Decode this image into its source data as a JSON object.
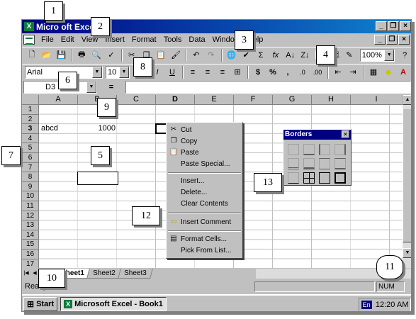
{
  "app": {
    "title": "Microsoft Excel - Book1",
    "title_visible": "Micro   oft Excel   1"
  },
  "menubar": {
    "items": [
      "File",
      "Edit",
      "View",
      "Insert",
      "Format",
      "Tools",
      "Data",
      "Window",
      "Help"
    ]
  },
  "toolbar": {
    "zoom": "100%",
    "font": "Arial",
    "size": "10",
    "currency": "$",
    "percent": "%",
    "autosum": "Σ",
    "function": "fx"
  },
  "formula_bar": {
    "name_box": "D3",
    "equals": "="
  },
  "sheet": {
    "columns": [
      "A",
      "B",
      "C",
      "D",
      "E",
      "F",
      "G",
      "H",
      "I"
    ],
    "rows": [
      "1",
      "2",
      "3",
      "4",
      "5",
      "6",
      "7",
      "8",
      "9",
      "10",
      "11",
      "12",
      "13",
      "14",
      "15",
      "16",
      "17"
    ],
    "cells": {
      "A3": "abcd",
      "B3": "1000"
    }
  },
  "tabs": [
    "Sheet1",
    "Sheet2",
    "Sheet3"
  ],
  "status": {
    "ready": "Ready",
    "num": "NUM"
  },
  "context_menu": {
    "cut": "Cut",
    "copy": "Copy",
    "paste": "Paste",
    "paste_special": "Paste Special...",
    "insert": "Insert...",
    "delete": "Delete...",
    "clear": "Clear Contents",
    "insert_comment": "Insert Comment",
    "format_cells": "Format Cells...",
    "pick_list": "Pick From List..."
  },
  "borders_palette": {
    "title": "Borders"
  },
  "taskbar": {
    "start": "Start",
    "task": "Microsoft Excel - Book1",
    "lang": "En",
    "clock": "12:20 AM"
  },
  "callouts": {
    "c1": "1",
    "c2": "2",
    "c3": "3",
    "c4": "4",
    "c5": "5",
    "c6": "6",
    "c7": "7",
    "c8": "8",
    "c9": "9",
    "c10": "10",
    "c11": "11",
    "c12": "12",
    "c13": "13"
  }
}
